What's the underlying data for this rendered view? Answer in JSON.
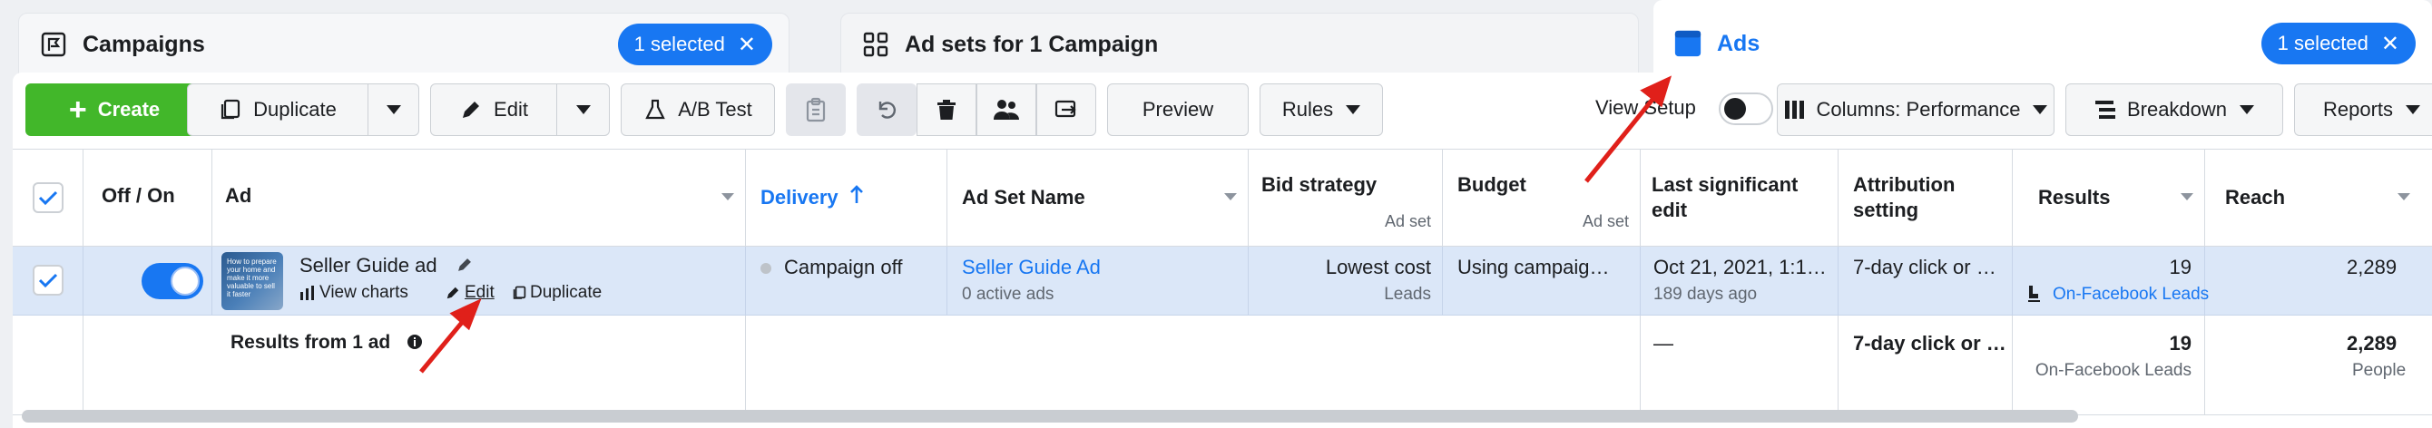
{
  "tabs": {
    "campaigns": {
      "label": "Campaigns",
      "pill": "1 selected"
    },
    "adsets": {
      "label": "Ad sets for 1 Campaign"
    },
    "ads": {
      "label": "Ads",
      "pill": "1 selected"
    }
  },
  "toolbar": {
    "create": "Create",
    "duplicate": "Duplicate",
    "edit": "Edit",
    "ab_test": "A/B Test",
    "preview": "Preview",
    "rules": "Rules",
    "view_setup": "View Setup",
    "columns": "Columns: Performance",
    "breakdown": "Breakdown",
    "reports": "Reports"
  },
  "table": {
    "headers": {
      "off_on": "Off / On",
      "ad": "Ad",
      "delivery": "Delivery",
      "ad_set_name": "Ad Set Name",
      "bid_strategy": "Bid strategy",
      "bid_strategy_sub": "Ad set",
      "budget": "Budget",
      "budget_sub": "Ad set",
      "last_edit_1": "Last significant",
      "last_edit_2": "edit",
      "attribution_1": "Attribution",
      "attribution_2": "setting",
      "results": "Results",
      "reach": "Reach"
    },
    "row": {
      "ad_name": "Seller Guide ad",
      "view_charts": "View charts",
      "edit": "Edit",
      "duplicate": "Duplicate",
      "thumb_text": "How to prepare your home and make it more valuable to sell it faster",
      "delivery": "Campaign off",
      "ad_set_name": "Seller Guide Ad",
      "ad_set_sub": "0 active ads",
      "bid_strategy": "Lowest cost",
      "bid_strategy_sub": "Leads",
      "budget": "Using campaig…",
      "last_edit": "Oct 21, 2021, 1:1…",
      "last_edit_sub": "189 days ago",
      "attribution": "7-day click or …",
      "results": "19",
      "results_sub": "On-Facebook Leads",
      "reach": "2,289"
    },
    "footer": {
      "label": "Results from 1 ad",
      "last_edit": "—",
      "attribution": "7-day click or …",
      "results": "19",
      "results_sub": "On-Facebook Leads",
      "reach": "2,289",
      "reach_sub": "People"
    }
  },
  "colors": {
    "accent": "#1877f2",
    "create": "#42b72a",
    "selected_row": "#dbe7f8",
    "annotation": "#e0201a"
  }
}
